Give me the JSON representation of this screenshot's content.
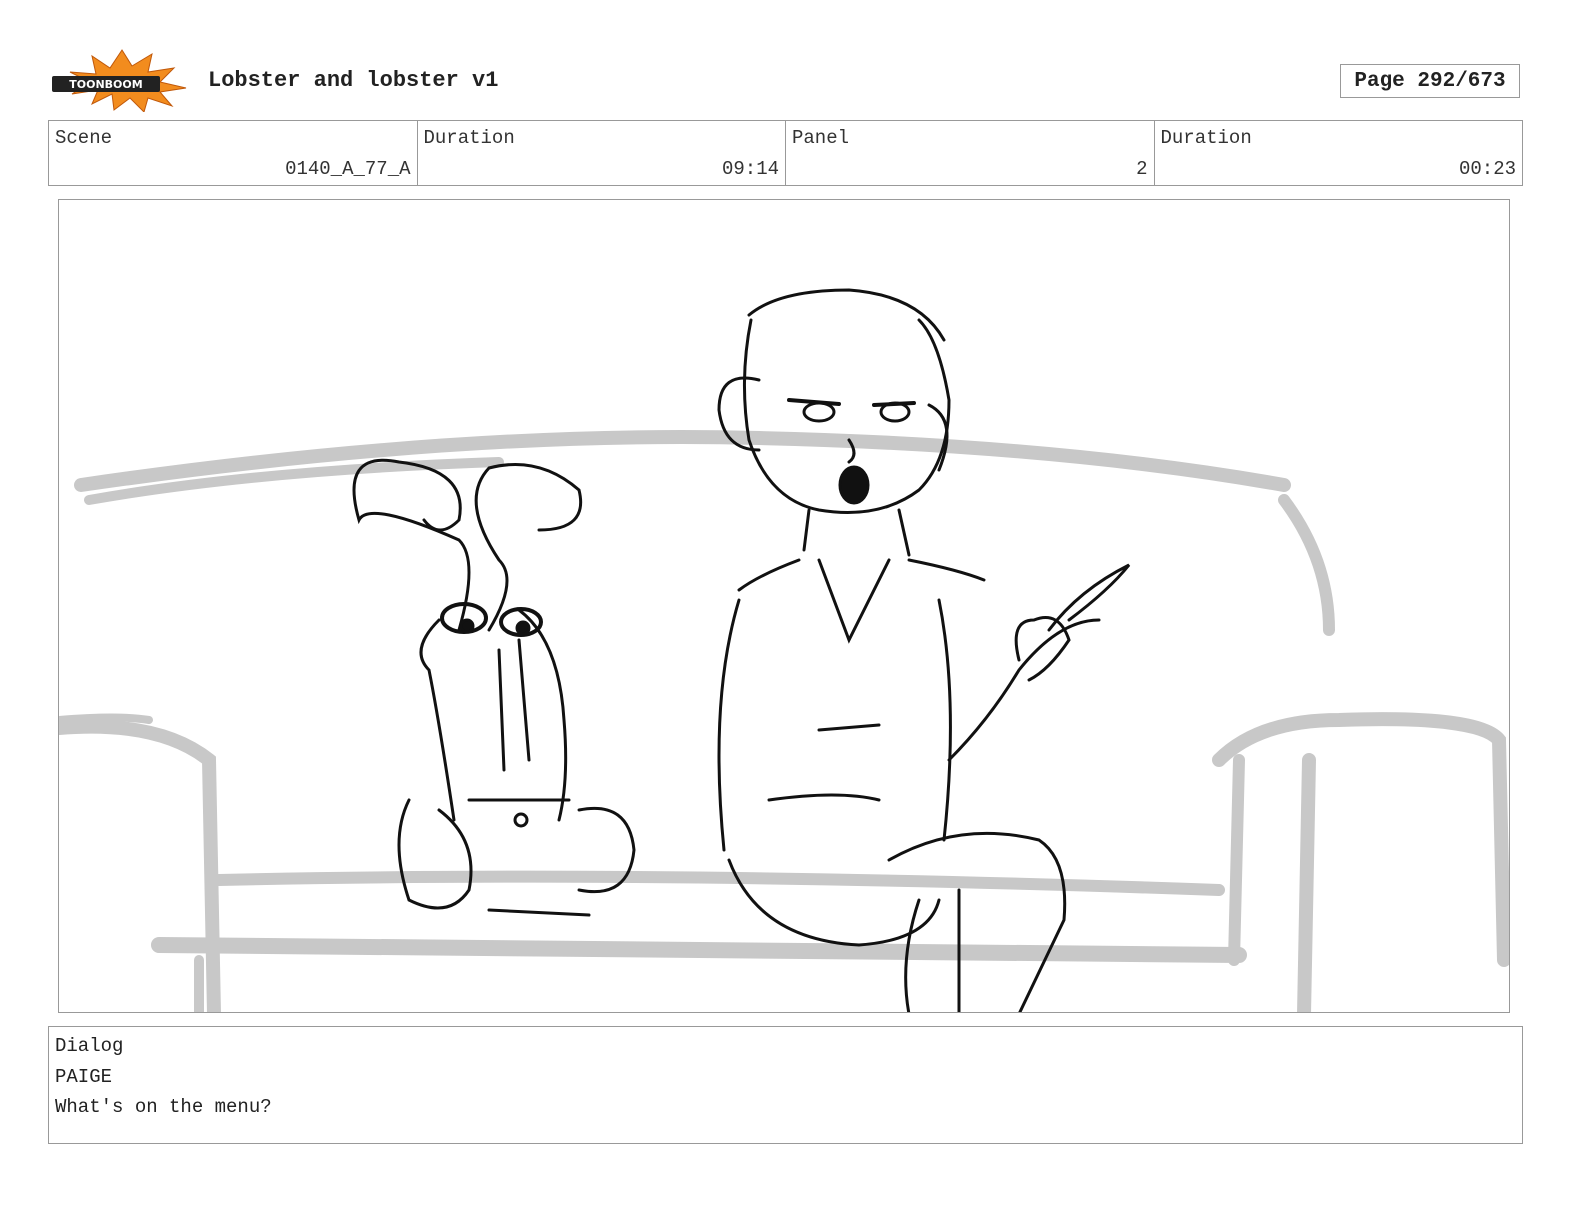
{
  "header": {
    "logo_text": "TOONBOOM",
    "project_title": "Lobster and lobster v1",
    "page_indicator": "Page 292/673"
  },
  "info": {
    "scene_label": "Scene",
    "scene_value": "0140_A_77_A",
    "scene_duration_label": "Duration",
    "scene_duration_value": "09:14",
    "panel_label": "Panel",
    "panel_value": "2",
    "panel_duration_label": "Duration",
    "panel_duration_value": "00:23"
  },
  "dialog": {
    "label": "Dialog",
    "speaker": "PAIGE",
    "line": "What's on the menu?"
  },
  "colors": {
    "logo_burst": "#f28c1e",
    "logo_banner": "#222222",
    "sketch_grey": "#c8c8c8",
    "sketch_ink": "#111111"
  }
}
